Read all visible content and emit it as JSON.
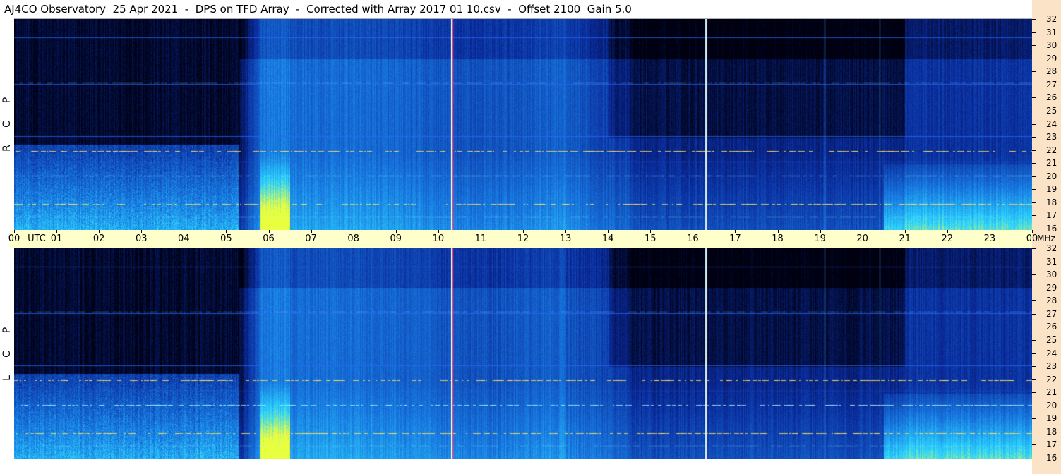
{
  "title": "AJ4CO Observatory  25 Apr 2021  -  DPS on TFD Array  -  Corrected with Array 2017 01 10.csv  -  Offset 2100  Gain 5.0",
  "panels": [
    {
      "id": "top",
      "polarization": [
        "R",
        "C",
        "P"
      ]
    },
    {
      "id": "bottom",
      "polarization": [
        "L",
        "C",
        "P"
      ]
    }
  ],
  "time_axis": {
    "unit_label": "UTC",
    "freq_unit_label": "MHz",
    "labels": [
      "00",
      "01",
      "02",
      "03",
      "04",
      "05",
      "06",
      "07",
      "08",
      "09",
      "10",
      "11",
      "12",
      "13",
      "14",
      "15",
      "16",
      "17",
      "18",
      "19",
      "20",
      "21",
      "22",
      "23",
      "00"
    ]
  },
  "freq_axis": {
    "labels": [
      "32",
      "31",
      "30",
      "29",
      "28",
      "27",
      "26",
      "25",
      "24",
      "23",
      "22",
      "21",
      "20",
      "19",
      "18",
      "17",
      "16"
    ]
  },
  "colors": {
    "background_dark": "#000010",
    "low": "#0a2a9a",
    "mid": "#1878e0",
    "high": "#2cd4ff",
    "peak": "#e8ff40",
    "axis_band": "#ffffcc",
    "right_strip": "#fbe3c7"
  },
  "chart_data": {
    "type": "heatmap",
    "title": "AJ4CO Observatory  25 Apr 2021  -  DPS on TFD Array  -  Corrected with Array 2017 01 10.csv  -  Offset 2100  Gain 5.0",
    "xlabel": "UTC",
    "ylabel": "MHz",
    "x_range_hours": [
      0,
      24
    ],
    "y_range_mhz": [
      16,
      32
    ],
    "series": [
      {
        "name": "RCP"
      },
      {
        "name": "LCP"
      }
    ],
    "features": {
      "dark_night_region_hours": [
        0,
        5.3
      ],
      "solar_dawn_bright_hours": [
        5.8,
        6.5
      ],
      "vertical_line_hours": [
        10.3,
        16.3,
        19.1,
        20.4
      ],
      "interference_bands_mhz": [
        17.0,
        18.0,
        20.1,
        22.0,
        27.2
      ]
    }
  }
}
